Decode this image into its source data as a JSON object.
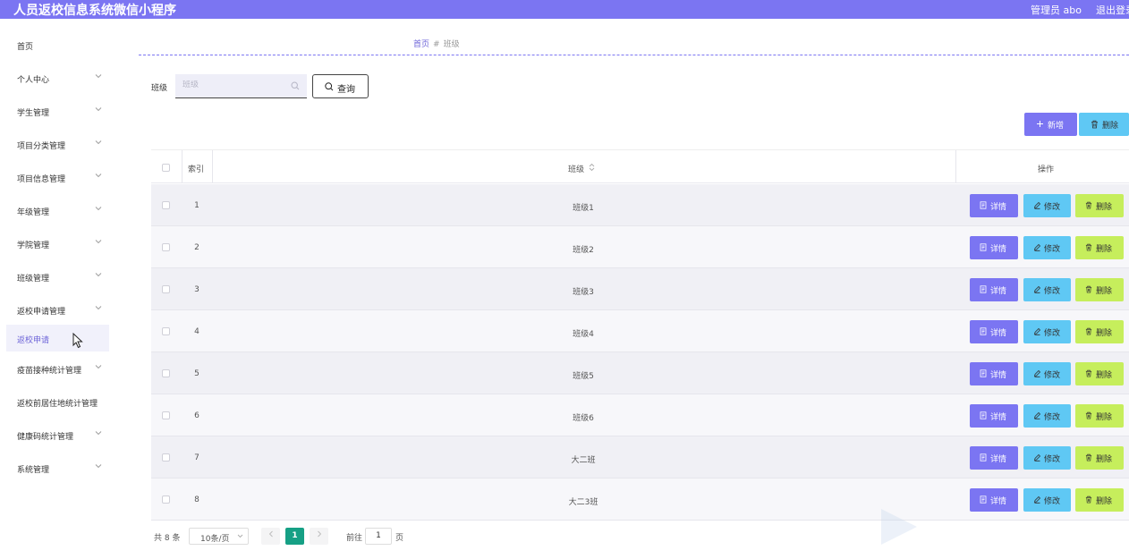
{
  "header": {
    "title": "人员返校信息系统微信小程序",
    "user": "管理员 abo",
    "logout": "退出登录"
  },
  "sidebar": {
    "items": [
      {
        "label": "首页"
      },
      {
        "label": "个人中心"
      },
      {
        "label": "学生管理"
      },
      {
        "label": "项目分类管理"
      },
      {
        "label": "项目信息管理"
      },
      {
        "label": "年级管理"
      },
      {
        "label": "学院管理"
      },
      {
        "label": "班级管理"
      },
      {
        "label": "返校申请管理"
      },
      {
        "label": "返校申请"
      },
      {
        "label": "疫苗接种统计管理"
      },
      {
        "label": "返校前居住地统计管理"
      },
      {
        "label": "健康码统计管理"
      },
      {
        "label": "系统管理"
      }
    ]
  },
  "breadcrumb": {
    "home": "首页",
    "separator": "#",
    "current": "班级"
  },
  "search": {
    "label": "班级",
    "placeholder": "班级",
    "value": "",
    "button_label": "查询"
  },
  "toolbar": {
    "add_label": "新增",
    "delete_label": "删除"
  },
  "table": {
    "headers": {
      "index": "索引",
      "class": "班级",
      "actions": "操作"
    },
    "action_labels": {
      "detail": "详情",
      "edit": "修改",
      "delete": "删除"
    },
    "rows": [
      {
        "index": "1",
        "class": "班级1"
      },
      {
        "index": "2",
        "class": "班级2"
      },
      {
        "index": "3",
        "class": "班级3"
      },
      {
        "index": "4",
        "class": "班级4"
      },
      {
        "index": "5",
        "class": "班级5"
      },
      {
        "index": "6",
        "class": "班级6"
      },
      {
        "index": "7",
        "class": "大二班"
      },
      {
        "index": "8",
        "class": "大二3班"
      }
    ]
  },
  "pagination": {
    "total": "共 8 条",
    "page_size": "10条/页",
    "current_page": "1",
    "goto_prefix": "前往",
    "goto_value": "1",
    "goto_suffix": "页"
  },
  "colors": {
    "primary": "#7b75f2",
    "info": "#5fc8f4",
    "lime": "#c6ee5c",
    "pager_active": "#16a085"
  }
}
